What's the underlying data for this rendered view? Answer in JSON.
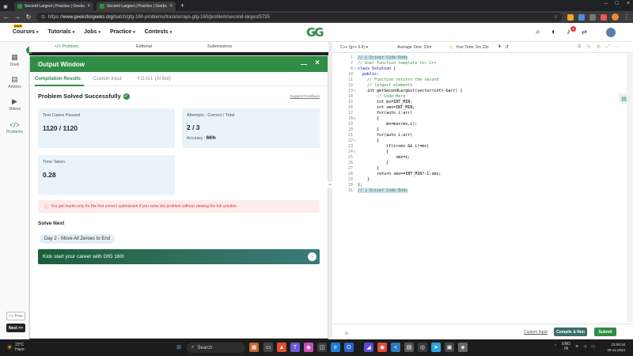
{
  "browser": {
    "tabs": [
      {
        "title": "Second Largest | Practice | Geeks"
      },
      {
        "title": "Second Largest | Practice | Geeks"
      }
    ],
    "url_prefix": "https://",
    "url_domain": "www.geeksforgeeks.org",
    "url_path": "/batch/gfg-160-problems/track/arrays-gfg-160/problem/second-largest3735",
    "notification_count": "1"
  },
  "site": {
    "sale_badge": "SALE",
    "logo": "GG",
    "menu": [
      "Courses",
      "Tutorials",
      "Jobs",
      "Practice",
      "Contests"
    ]
  },
  "sidebar": {
    "items": [
      {
        "label": "Dash",
        "icon": "grid-icon"
      },
      {
        "label": "Articles",
        "icon": "article-icon"
      },
      {
        "label": "Videos",
        "icon": "video-icon"
      },
      {
        "label": "Problems",
        "icon": "code-icon"
      }
    ],
    "prev": "<< Prev",
    "next": "Next >>"
  },
  "problem_tabs": {
    "problem": "</> Problem",
    "editorial": "Editorial",
    "submissions": "Submissions"
  },
  "output_window": {
    "title": "Output Window",
    "tabs": [
      "Compilation Results",
      "Custom Input",
      "Y.O.G.I. (AI Bot)"
    ],
    "status": "Problem Solved Successfully",
    "feedback": "Suggest Feedback",
    "test_cases_label": "Test Cases Passed",
    "test_cases_value": "1120 / 1120",
    "attempts_label": "Attempts : Correct / Total",
    "attempts_value": "2 / 3",
    "accuracy_label": "Accuracy :",
    "accuracy_value": "66%",
    "time_label": "Time Taken",
    "time_value": "0.28",
    "warning": "You get marks only for the first correct submission if you solve the problem without viewing the full solution.",
    "solve_next": "Solve Next",
    "next_problem": "Day 2 - Move All Zeroes to End",
    "banner": "Kick start your career with GfG 160!"
  },
  "editor": {
    "language": "C++ (g++ 5.4)",
    "avg_time": "Average Time: 15m",
    "your_time": "Your Time: 5m 23s",
    "lines": [
      {
        "n": "1",
        "text": "// } Driver Code Ends",
        "cls": "cm hl",
        "fold": "-"
      },
      {
        "n": "7",
        "text": "// User function template for C++",
        "cls": "cm",
        "fold": ""
      },
      {
        "n": "8",
        "text": "class Solution {",
        "cls": "kw",
        "fold": "v"
      },
      {
        "n": "10",
        "text": "  public:",
        "cls": "kw",
        "fold": ""
      },
      {
        "n": "11",
        "text": "    // Function returns the second",
        "cls": "cm",
        "fold": ""
      },
      {
        "n": "12",
        "text": "    // largest elements",
        "cls": "cm",
        "fold": ""
      },
      {
        "n": "13",
        "text": "    int getSecondLargest(vector<int> &arr) {",
        "cls": "",
        "fold": "v"
      },
      {
        "n": "14",
        "text": "        // Code Here",
        "cls": "cm",
        "fold": ""
      },
      {
        "n": "15",
        "text": "        int mx=INT_MIN;",
        "cls": "",
        "fold": ""
      },
      {
        "n": "16",
        "text": "        int smx=INT_MIN;",
        "cls": "",
        "fold": ""
      },
      {
        "n": "17",
        "text": "        for(auto i:arr)",
        "cls": "",
        "fold": ""
      },
      {
        "n": "18",
        "text": "        {",
        "cls": "",
        "fold": "v"
      },
      {
        "n": "19",
        "text": "            mx=max(mx,i);",
        "cls": "",
        "fold": ""
      },
      {
        "n": "20",
        "text": "        }",
        "cls": "",
        "fold": ""
      },
      {
        "n": "21",
        "text": "        for(auto i:arr)",
        "cls": "",
        "fold": ""
      },
      {
        "n": "22",
        "text": "        {",
        "cls": "",
        "fold": "v"
      },
      {
        "n": "23",
        "text": "            if(i>smx && i!=mx)",
        "cls": "",
        "fold": ""
      },
      {
        "n": "24",
        "text": "            {",
        "cls": "",
        "fold": "v"
      },
      {
        "n": "25",
        "text": "                smx=i;",
        "cls": "",
        "fold": ""
      },
      {
        "n": "26",
        "text": "            }",
        "cls": "",
        "fold": ""
      },
      {
        "n": "27",
        "text": "        }",
        "cls": "",
        "fold": ""
      },
      {
        "n": "28",
        "text": "        return smx==INT_MIN?-1:smx;",
        "cls": "",
        "fold": ""
      },
      {
        "n": "29",
        "text": "    }",
        "cls": "",
        "fold": ""
      },
      {
        "n": "30",
        "text": "};",
        "cls": "",
        "fold": ""
      },
      {
        "n": "31",
        "text": "// } Driver Code Ends",
        "cls": "cm hl",
        "fold": "-"
      }
    ],
    "custom_input": "Custom Input",
    "compile": "Compile & Run",
    "submit": "Submit"
  },
  "taskbar": {
    "temp": "23°C",
    "weather": "Haze",
    "search": "Search",
    "lang": "ENG",
    "region": "IN",
    "time": "23:08:18",
    "date": "28-11-2024"
  }
}
